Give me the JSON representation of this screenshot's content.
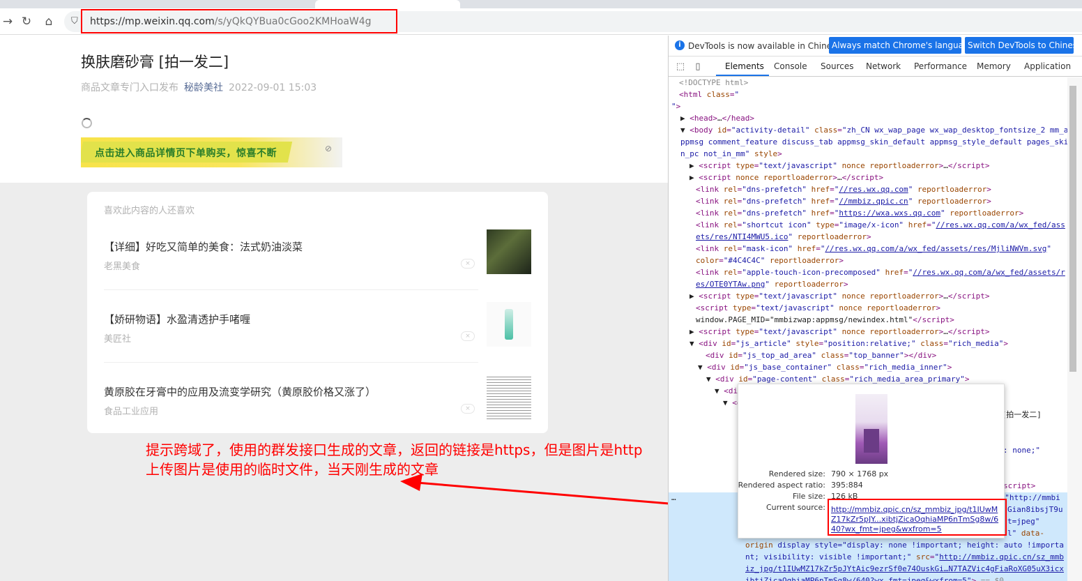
{
  "browser": {
    "url_host": "https://mp.weixin.qq.com",
    "url_rest": "/s/yQkQYBua0cGoo2KMHoaW4g"
  },
  "article": {
    "title": "换肤磨砂膏 [拍一发二]",
    "meta_source": "商品文章专门入口发布",
    "meta_author": "秘龄美社",
    "meta_time": "2022-09-01 15:03",
    "banner_text": "点击进入商品详情页下单购买，惊喜不断"
  },
  "recommend": {
    "heading": "喜欢此内容的人还喜欢",
    "items": [
      {
        "title": "【详细】好吃又简单的美食：法式奶油淡菜",
        "source": "老黑美食"
      },
      {
        "title": "【娇研物语】水盈清透护手啫喱",
        "source": "美匠社"
      },
      {
        "title": "黄原胶在牙膏中的应用及流变学研究（黄原胶价格又涨了）",
        "source": "食品工业应用"
      }
    ]
  },
  "annotation": {
    "line1": "提示跨域了，使用的群发接口生成的文章，返回的链接是https，但是图片是http",
    "line2": "上传图片是使用的临时文件，当天刚生成的文章"
  },
  "devtools": {
    "info_msg": "DevTools is now available in Chinese!",
    "btn_match": "Always match Chrome's language",
    "btn_switch": "Switch DevTools to Chinese",
    "tabs": [
      "Elements",
      "Console",
      "Sources",
      "Network",
      "Performance",
      "Memory",
      "Application"
    ],
    "popup": {
      "rendered_size_label": "Rendered size:",
      "rendered_size": "790 × 1768 px",
      "aspect_label": "Rendered aspect ratio:",
      "aspect": "395:884",
      "filesize_label": "File size:",
      "filesize": "126 kB",
      "source_label": "Current source:",
      "source": "http://mmbiz.qpic.cn/sz_mmbiz_jpg/t1IUwMZ17kZr5pJY...xibtjZicaOqhiaMP6nTmSg8w/640?wx_fmt=jpeg&wxfrom=5"
    }
  }
}
